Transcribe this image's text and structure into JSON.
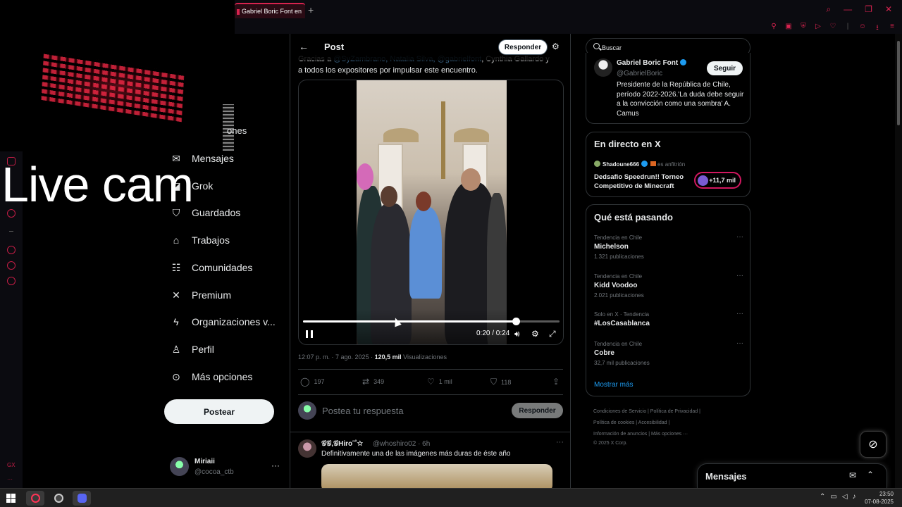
{
  "browser": {
    "active_tab_title": "Gabriel Boric Font en",
    "new_tab_glyph": "+",
    "back_glyph": "‹"
  },
  "overlay": {
    "text": "Live cam"
  },
  "nav": {
    "partial_label": "ones",
    "items": [
      {
        "label": "Mensajes",
        "icon": "mail-icon"
      },
      {
        "label": "Grok",
        "icon": "grok-icon"
      },
      {
        "label": "Guardados",
        "icon": "bookmark-icon"
      },
      {
        "label": "Trabajos",
        "icon": "briefcase-icon"
      },
      {
        "label": "Comunidades",
        "icon": "people-icon"
      },
      {
        "label": "Premium",
        "icon": "x-logo-icon"
      },
      {
        "label": "Organizaciones v...",
        "icon": "bolt-icon"
      },
      {
        "label": "Perfil",
        "icon": "person-icon"
      },
      {
        "label": "Más opciones",
        "icon": "more-circle-icon"
      }
    ],
    "post_button": "Postear",
    "account": {
      "name": "Miriaii",
      "handle": "@cocoa_ctb",
      "more": "···"
    }
  },
  "post": {
    "header_title": "Post",
    "header_reply": "Responder",
    "text_line1_start": "Gracias a ",
    "text_line1_muted": "@SyZambrano, Natalia Silva, @gabrielfont",
    "text_line1_end": ", Cynthia Gallardo y",
    "text_line2": "a todos los expositores por impulsar este encuentro.",
    "video": {
      "time": "0:20 / 0:24",
      "progress": 0.83
    },
    "timestamp": "12:07 p. m. · 7 ago. 2025 · ",
    "views_count": "120,5 mil",
    "views_label": " Visualizaciones",
    "actions": {
      "replies": "197",
      "reposts": "349",
      "likes": "1 mil",
      "bookmarks": "118"
    },
    "reply_placeholder": "Postea tu respuesta",
    "reply_button": "Responder"
  },
  "reply_tweet": {
    "name": "𝒢𝒢,𝒢Hiro˜˚☆",
    "handle": "@whoshiro02 · 6h",
    "more": "···",
    "text": "Definitivamente una de las imágenes más duras de éste año"
  },
  "right": {
    "search_placeholder": "Buscar",
    "profile": {
      "name": "Gabriel Boric Font",
      "handle": "@GabrielBoric",
      "follow": "Seguir",
      "bio": "Presidente de la República de Chile, período 2022-2026.'La duda debe seguir a la convicción como una sombra' A. Camus"
    },
    "live": {
      "title": "En directo en X",
      "host_name": "Shadoune666",
      "host_label": "es anfitrión",
      "stream_title": "Dedsafio Speedrun!! Torneo Competitivo de Minecraft",
      "viewers": "+11,7 mil"
    },
    "trends": {
      "title": "Qué está pasando",
      "items": [
        {
          "context": "Tendencia en Chile",
          "topic": "Michelson",
          "count": "1.321 publicaciones"
        },
        {
          "context": "Tendencia en Chile",
          "topic": "Kidd Voodoo",
          "count": "2.021 publicaciones"
        },
        {
          "context": "Solo en X · Tendencia",
          "topic": "#LosCasablanca",
          "count": ""
        },
        {
          "context": "Tendencia en Chile",
          "topic": "Cobre",
          "count": "32,7 mil publicaciones"
        }
      ],
      "more_dots": "···",
      "show_more": "Mostrar más"
    },
    "footer": {
      "line1": "Condiciones de Servicio  |  Política de Privacidad  |",
      "line2": "Política de cookies  |  Accesibilidad  |",
      "line3": "Información de anuncios  |  Más opciones ···",
      "line4": "© 2025 X Corp."
    }
  },
  "messages_dock": {
    "title": "Mensajes"
  },
  "taskbar": {
    "time": "23:50",
    "date": "07-08-2025"
  },
  "colors": {
    "accent": "#d8234f",
    "x_blue": "#1d9bf0",
    "live_ring": "#d21860"
  }
}
